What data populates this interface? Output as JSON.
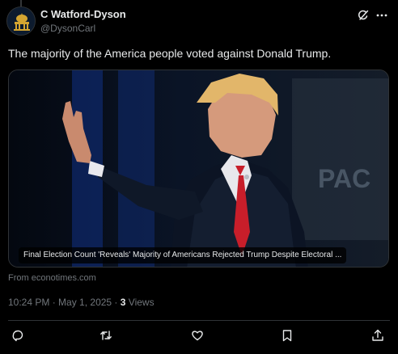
{
  "author": {
    "display_name": "C Watford-Dyson",
    "handle": "@DysonCarl"
  },
  "post": {
    "text": "The majority of the America people voted against Donald Trump."
  },
  "card": {
    "caption": "Final Election Count 'Reveals' Majority of Americans Rejected Trump Despite Electoral ...",
    "source": "From econotimes.com"
  },
  "meta": {
    "time": "10:24 PM",
    "separator": " · ",
    "date": "May 1, 2025",
    "views_count": "3",
    "views_label": " Views"
  },
  "icons": {
    "top": [
      "grok-icon",
      "more-icon"
    ],
    "actions": [
      "reply-icon",
      "repost-icon",
      "like-icon",
      "bookmark-icon",
      "share-icon"
    ]
  },
  "colors": {
    "background": "#000000",
    "text_primary": "#e7e9ea",
    "text_secondary": "#71767b",
    "border": "#2f3336"
  }
}
